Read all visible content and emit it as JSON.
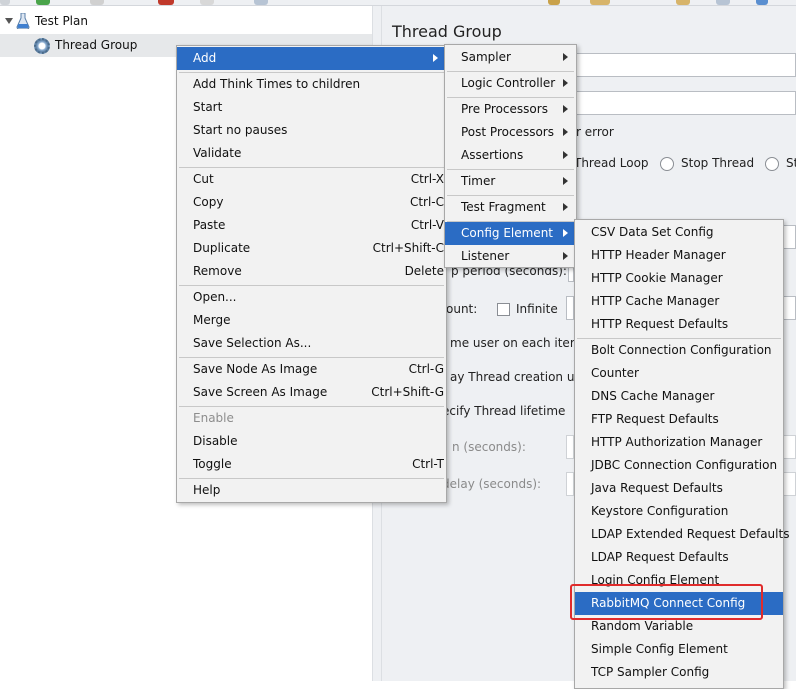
{
  "toolbar": {
    "icons": [
      {
        "name": "cut-icon",
        "color": "#d53a3a"
      },
      {
        "name": "copy-icon",
        "color": "#4aa44a"
      },
      {
        "name": "paste-icon",
        "color": "#d0d0d0"
      },
      {
        "name": "scissors-icon",
        "color": "#c0392b"
      },
      {
        "name": "tool-icon",
        "color": "#c9a24a"
      },
      {
        "name": "broom-icon",
        "color": "#d7b46a"
      },
      {
        "name": "help-icon",
        "color": "#5a8fd0"
      }
    ]
  },
  "tree": {
    "items": [
      {
        "label": "Test Plan",
        "icon": "flask-icon"
      },
      {
        "label": "Thread Group",
        "icon": "gear-icon"
      }
    ]
  },
  "panel": {
    "title": "Thread Group",
    "on_error_fragment": "r error",
    "radio_thread_loop": "Thread Loop",
    "radio_stop_thread": "Stop Thread",
    "radio_stop_fragment": "St",
    "ramp_up_fragment": "p period (seconds):",
    "loop_count_fragment": "ount:",
    "infinite_label": "Infinite",
    "same_user_fragment": "me user on each iteratio",
    "delay_creation_fragment": "ay Thread creation until",
    "specify_lifetime_fragment": "ecify Thread lifetime",
    "duration_fragment": "n (seconds):",
    "startup_delay_fragment": "delay (seconds):"
  },
  "context_menu": {
    "groups": [
      [
        {
          "label": "Add",
          "submenu": true,
          "active": true
        }
      ],
      [
        {
          "label": "Add Think Times to children"
        },
        {
          "label": "Start"
        },
        {
          "label": "Start no pauses"
        },
        {
          "label": "Validate"
        }
      ],
      [
        {
          "label": "Cut",
          "shortcut": "Ctrl-X"
        },
        {
          "label": "Copy",
          "shortcut": "Ctrl-C"
        },
        {
          "label": "Paste",
          "shortcut": "Ctrl-V"
        },
        {
          "label": "Duplicate",
          "shortcut": "Ctrl+Shift-C"
        },
        {
          "label": "Remove",
          "shortcut": "Delete"
        }
      ],
      [
        {
          "label": "Open..."
        },
        {
          "label": "Merge"
        },
        {
          "label": "Save Selection As..."
        }
      ],
      [
        {
          "label": "Save Node As Image",
          "shortcut": "Ctrl-G"
        },
        {
          "label": "Save Screen As Image",
          "shortcut": "Ctrl+Shift-G"
        }
      ],
      [
        {
          "label": "Enable",
          "disabled": true
        },
        {
          "label": "Disable"
        },
        {
          "label": "Toggle",
          "shortcut": "Ctrl-T"
        }
      ],
      [
        {
          "label": "Help"
        }
      ]
    ]
  },
  "add_submenu": {
    "groups": [
      [
        {
          "label": "Sampler",
          "submenu": true
        }
      ],
      [
        {
          "label": "Logic Controller",
          "submenu": true
        }
      ],
      [
        {
          "label": "Pre Processors",
          "submenu": true
        },
        {
          "label": "Post Processors",
          "submenu": true
        },
        {
          "label": "Assertions",
          "submenu": true
        }
      ],
      [
        {
          "label": "Timer",
          "submenu": true
        }
      ],
      [
        {
          "label": "Test Fragment",
          "submenu": true
        }
      ],
      [
        {
          "label": "Config Element",
          "submenu": true,
          "active": true
        },
        {
          "label": "Listener",
          "submenu": true
        }
      ]
    ]
  },
  "config_submenu": {
    "groups": [
      [
        {
          "label": "CSV Data Set Config"
        },
        {
          "label": "HTTP Header Manager"
        },
        {
          "label": "HTTP Cookie Manager"
        },
        {
          "label": "HTTP Cache Manager"
        },
        {
          "label": "HTTP Request Defaults"
        }
      ],
      [
        {
          "label": "Bolt Connection Configuration"
        },
        {
          "label": "Counter"
        },
        {
          "label": "DNS Cache Manager"
        },
        {
          "label": "FTP Request Defaults"
        },
        {
          "label": "HTTP Authorization Manager"
        },
        {
          "label": "JDBC Connection Configuration"
        },
        {
          "label": "Java Request Defaults"
        },
        {
          "label": "Keystore Configuration"
        },
        {
          "label": "LDAP Extended Request Defaults"
        },
        {
          "label": "LDAP Request Defaults"
        },
        {
          "label": "Login Config Element"
        },
        {
          "label": "RabbitMQ Connect Config",
          "active": true
        },
        {
          "label": "Random Variable"
        },
        {
          "label": "Simple Config Element"
        },
        {
          "label": "TCP Sampler Config"
        }
      ]
    ]
  },
  "colors": {
    "menu_highlight": "#2b6cc4",
    "annotation_box": "#e02b2b"
  }
}
